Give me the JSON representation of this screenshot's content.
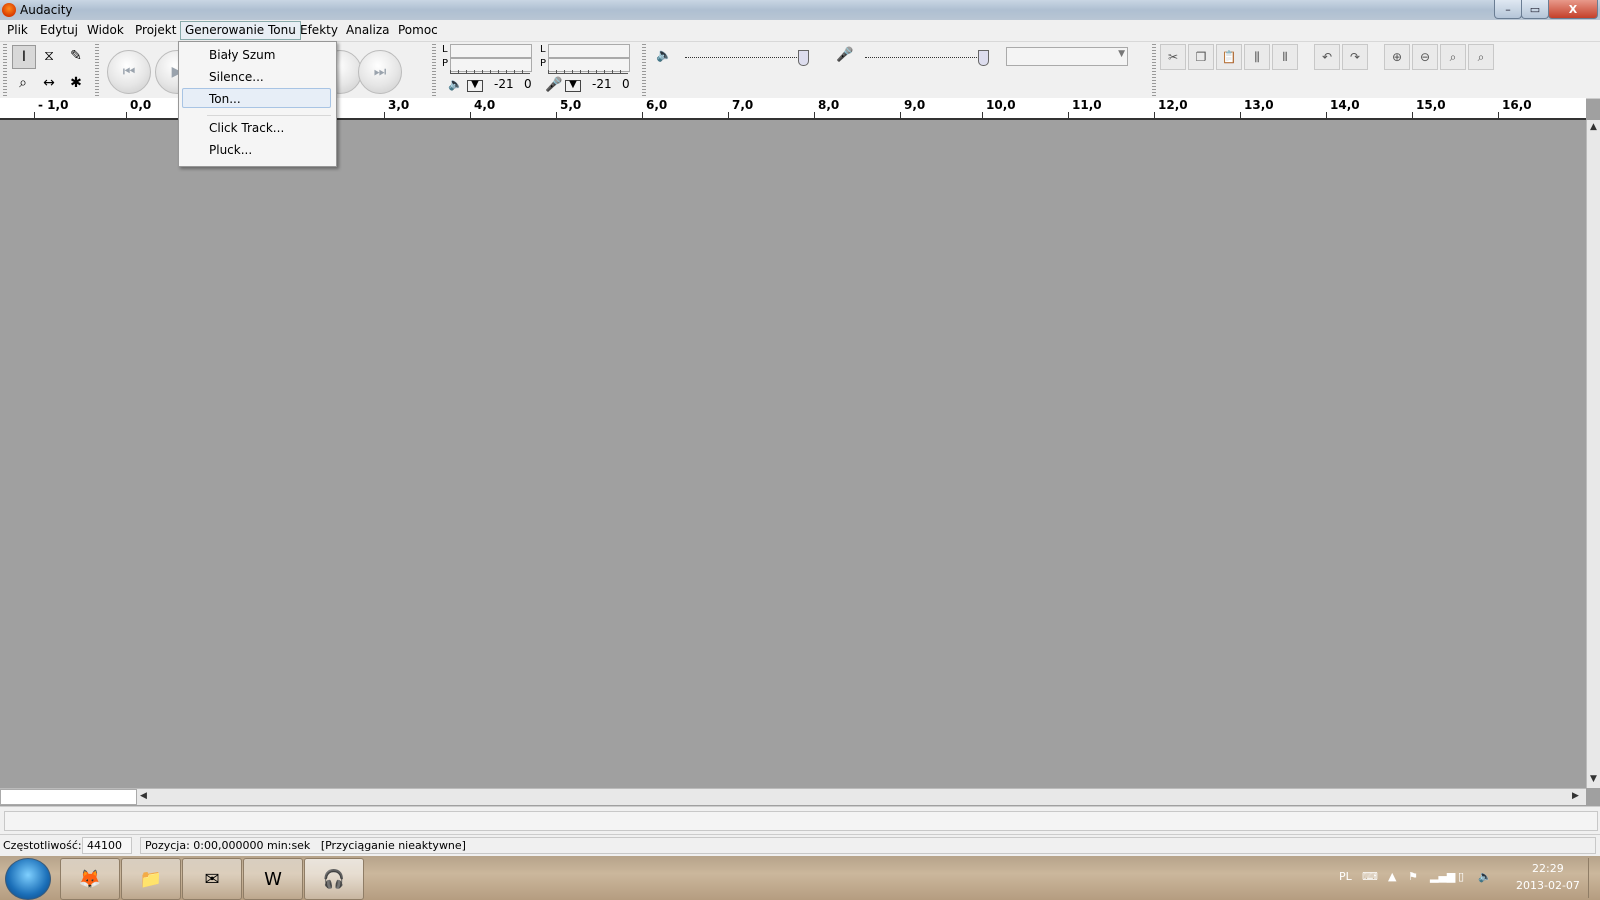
{
  "window": {
    "title": "Audacity",
    "btn_min": "–",
    "btn_max": "▭",
    "btn_close": "X"
  },
  "menu": [
    "Plik",
    "Edytuj",
    "Widok",
    "Projekt",
    "Generowanie Tonu",
    "Efekty",
    "Analiza",
    "Pomoc"
  ],
  "dropdown": [
    "Biały Szum",
    "Silence...",
    "Ton...",
    "Click Track...",
    "Pluck..."
  ],
  "meters": {
    "out_L": "L",
    "out_P": "P",
    "in_L": "L",
    "in_P": "P",
    "out_db": "-21",
    "out_zero": "0",
    "in_db": "-21",
    "in_zero": "0"
  },
  "ruler": [
    "- 1,0",
    "0,0",
    "3,0",
    "4,0",
    "5,0",
    "6,0",
    "7,0",
    "8,0",
    "9,0",
    "10,0",
    "11,0",
    "12,0",
    "13,0",
    "14,0",
    "15,0",
    "16,0"
  ],
  "status": {
    "rate_label": "Częstotliwość:",
    "rate_value": "44100",
    "position": "Pozycja: 0:00,000000 min:sek",
    "snap": "[Przyciąganie nieaktywne]"
  },
  "taskbar": {
    "lang": "PL",
    "time": "22:29",
    "date": "2013-02-07"
  },
  "colors": {
    "accent": "#1b6fb8",
    "workspace": "#a0a0a0"
  }
}
